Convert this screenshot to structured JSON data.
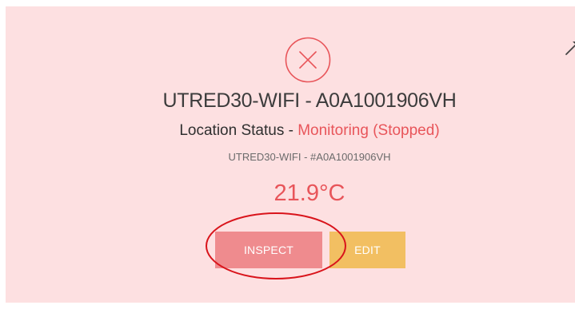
{
  "card": {
    "status_icon": "close-circle-icon",
    "corner_icon": "pin-icon",
    "title": "UTRED30-WIFI - A0A1001906VH",
    "location_label": "Location Status",
    "location_separator": " - ",
    "location_value": "Monitoring (Stopped)",
    "device_id": "UTRED30-WIFI - #A0A1001906VH",
    "temperature": "21.9°C",
    "buttons": {
      "inspect_label": "INSPECT",
      "edit_label": "EDIT"
    }
  },
  "colors": {
    "card_background": "#fde0e1",
    "alert": "#e8555a",
    "inspect_button": "#ef8b8e",
    "edit_button": "#f2bf62",
    "annotation": "#d9141b"
  },
  "annotation": {
    "shape": "ellipse",
    "target": "inspect-button"
  }
}
